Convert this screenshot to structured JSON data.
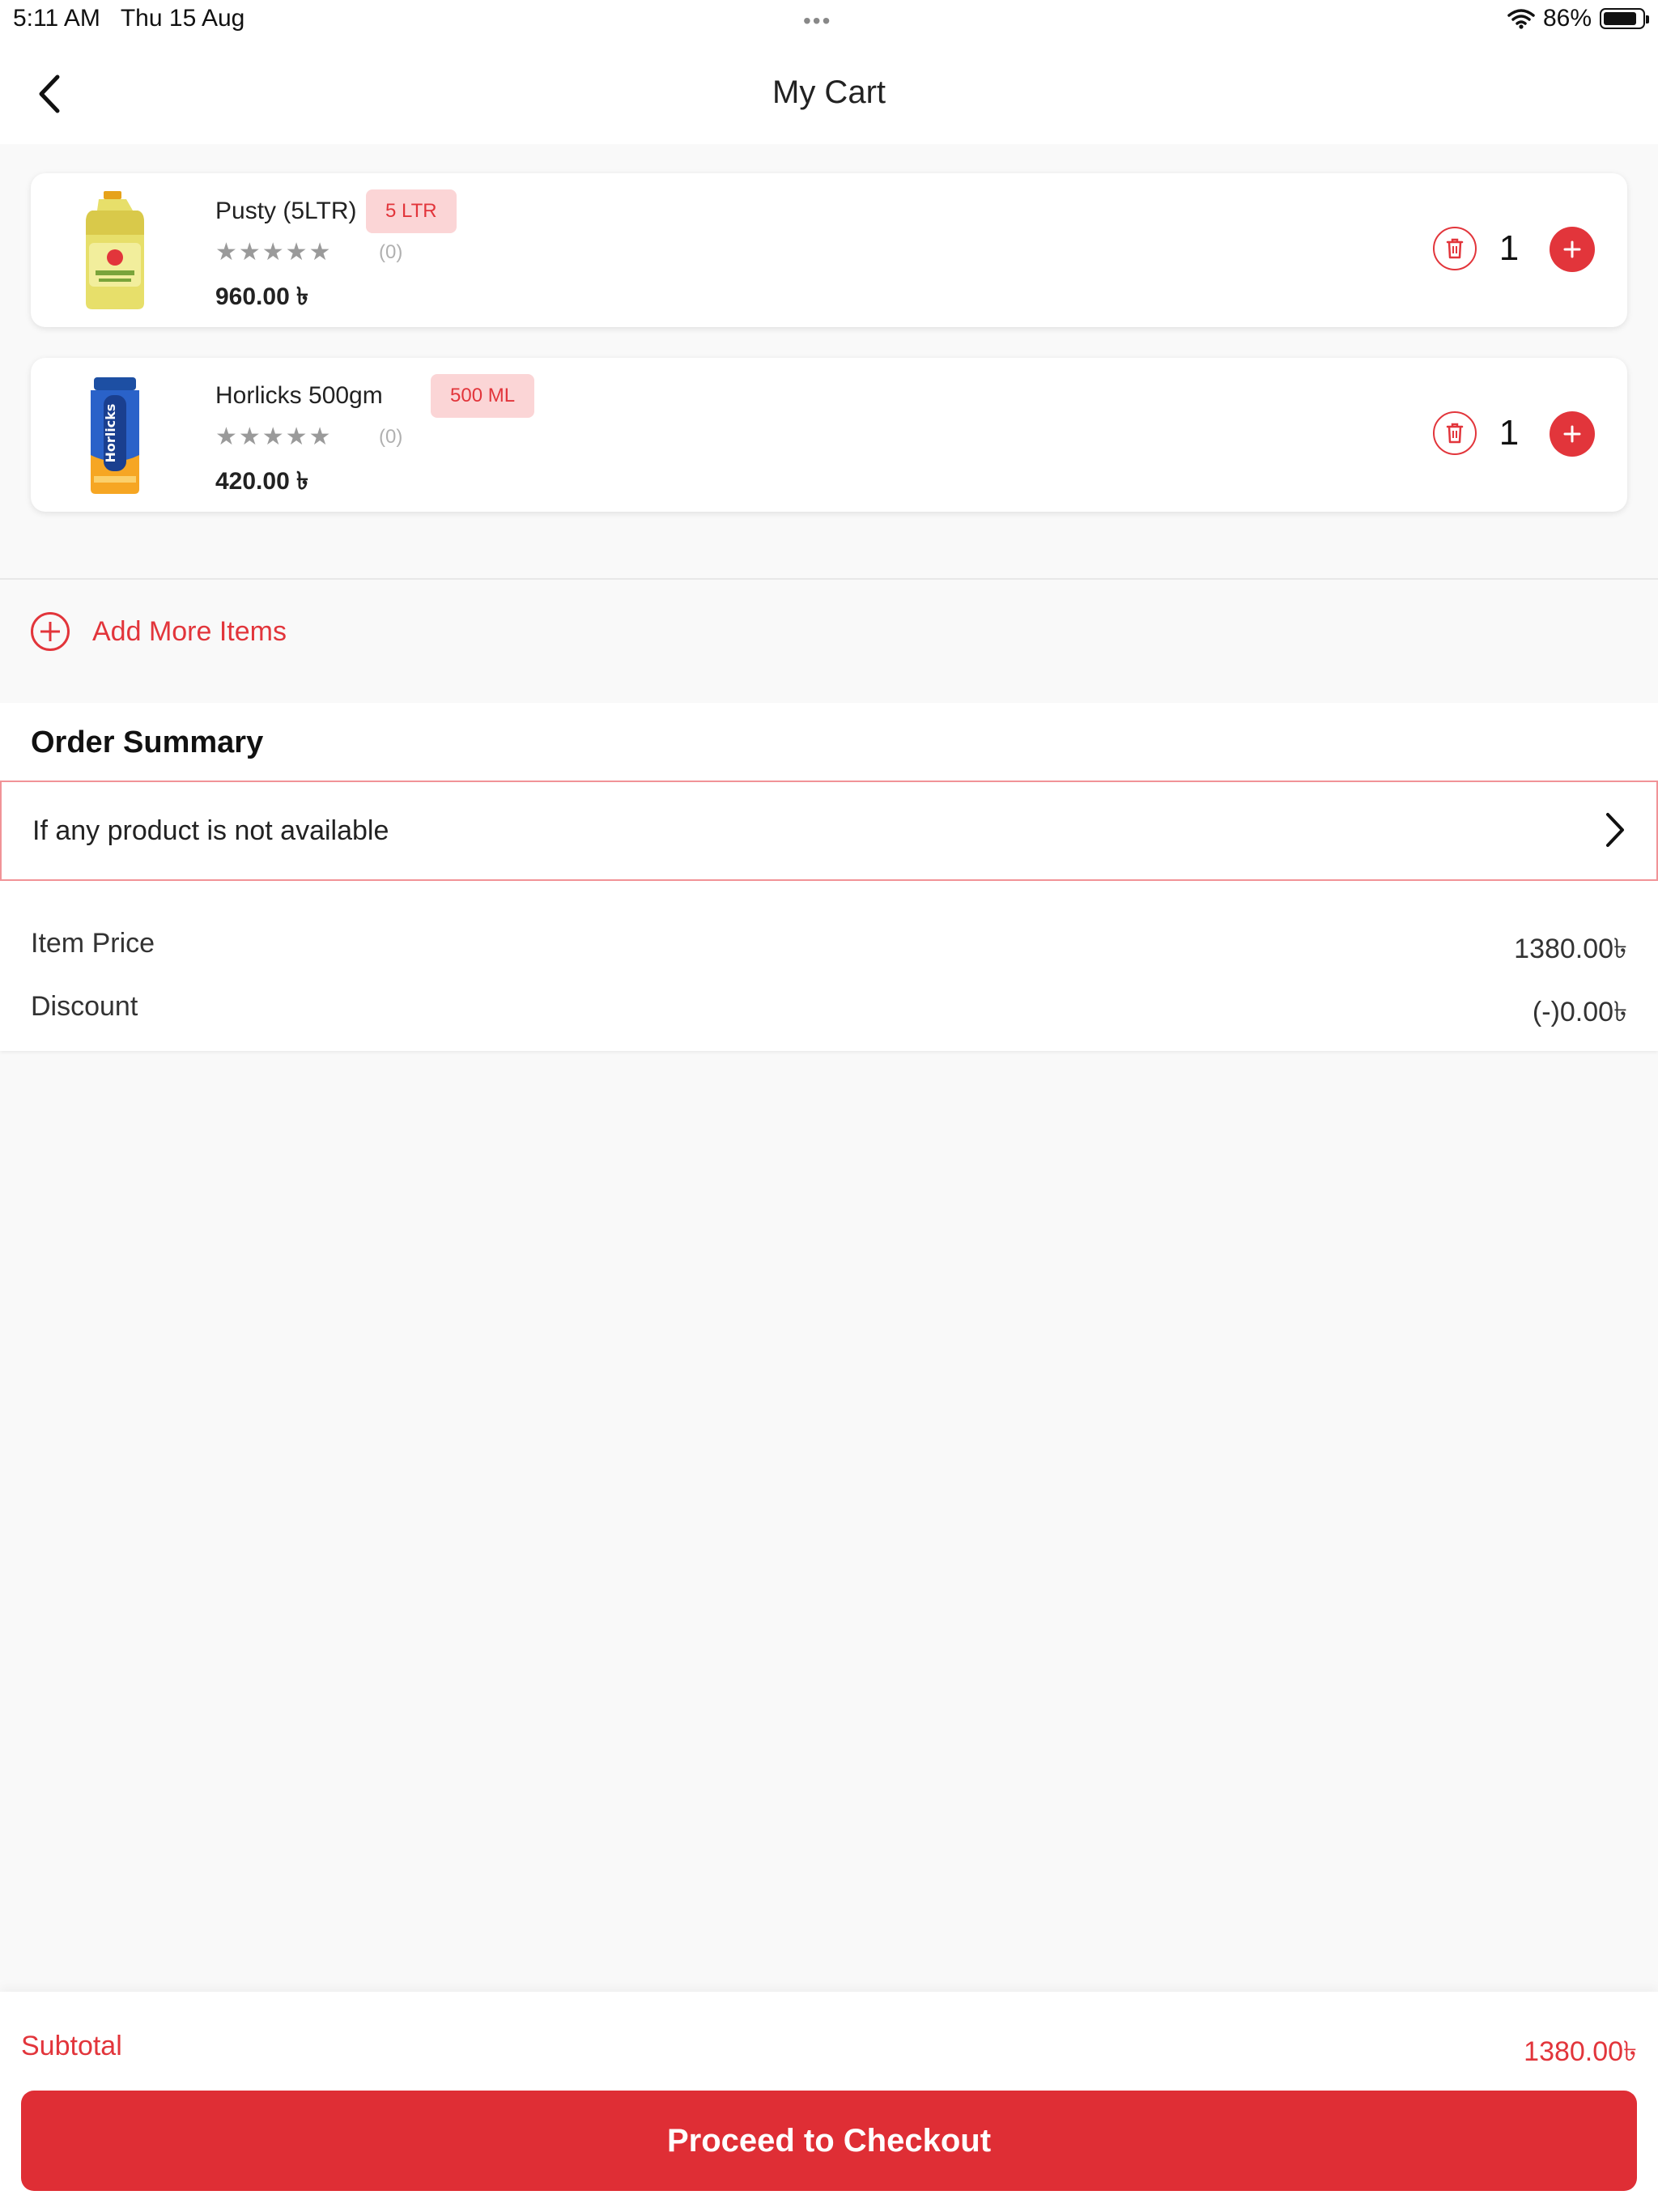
{
  "status_bar": {
    "time": "5:11 AM",
    "date": "Thu 15 Aug",
    "battery": "86%",
    "battery_level": 0.86
  },
  "header": {
    "title": "My Cart"
  },
  "cart": {
    "items": [
      {
        "name": "Pusty (5LTR)",
        "variant": "5 LTR",
        "stars": "★★★★★",
        "rating_count": "(0)",
        "price": "960.00 ৳",
        "qty": "1"
      },
      {
        "name": "Horlicks 500gm",
        "variant": "500 ML",
        "stars": "★★★★★",
        "rating_count": "(0)",
        "price": "420.00 ৳",
        "qty": "1"
      }
    ]
  },
  "add_more": {
    "label": "Add More Items"
  },
  "summary": {
    "title": "Order Summary",
    "unavailable_label": "If any product is not available",
    "rows": [
      {
        "label": "Item Price",
        "value": "1380.00৳"
      },
      {
        "label": "Discount",
        "value": "(-)0.00৳"
      }
    ]
  },
  "footer": {
    "subtotal_label": "Subtotal",
    "subtotal_value": "1380.00৳",
    "checkout_label": "Proceed to Checkout"
  },
  "colors": {
    "accent": "#e2353b",
    "badge_bg": "#fbd5d6",
    "page_bg": "#f9f9f9"
  },
  "icons": [
    "back-chevron-icon",
    "trash-icon",
    "plus-icon",
    "add-circle-icon",
    "chevron-right-icon",
    "wifi-icon",
    "battery-icon"
  ]
}
